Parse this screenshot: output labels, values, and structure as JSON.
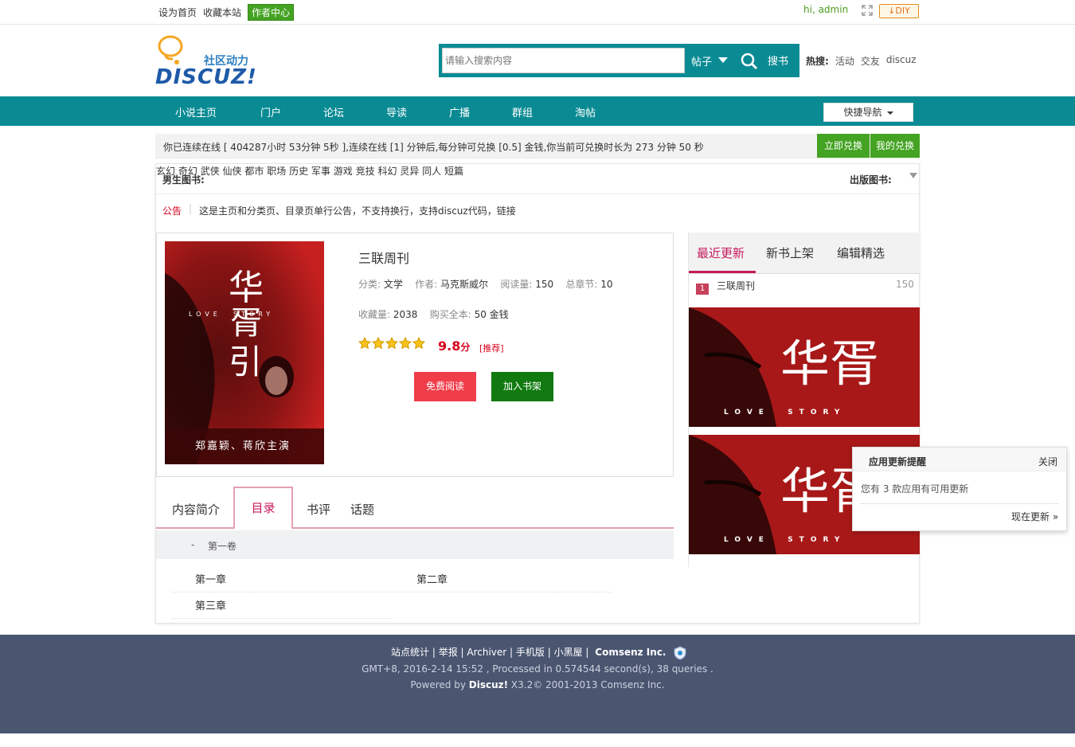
{
  "topbar": {
    "set_home": "设为首页",
    "bookmark": "收藏本站",
    "author_center": "作者中心",
    "greeting": "hi, admin",
    "diy": "DIY"
  },
  "header": {
    "logo_cn": "社区动力",
    "logo_en": "DISCUZ!",
    "search_placeholder": "请输入搜索内容",
    "search_type": "帖子",
    "search_button": "搜书",
    "hot_label": "热搜:",
    "hot_terms": [
      "活动",
      "交友",
      "discuz"
    ]
  },
  "nav": {
    "items": [
      "小说主页",
      "门户",
      "论坛",
      "导读",
      "广播",
      "群组",
      "淘帖"
    ],
    "quick_nav": "快捷导航"
  },
  "online": {
    "text": "你已连续在线 [ 404287小时 53分钟 5秒 ],连续在线 [1] 分钟后,每分钟可兑换 [0.5] 金钱,你当前可兑换时长为 273 分钟 50 秒",
    "exchange_now": "立即兑换",
    "my_exchange": "我的兑换"
  },
  "categories": {
    "male_label": "男生图书:",
    "items": [
      "玄幻",
      "奇幻",
      "武侠",
      "仙侠",
      "都市",
      "职场",
      "历史",
      "军事",
      "游戏",
      "竞技",
      "科幻",
      "灵异",
      "同人",
      "短篇"
    ],
    "publish_label": "出版图书:"
  },
  "notice": {
    "label": "公告",
    "text": "这是主页和分类页、目录页单行公告，不支持换行，支持discuz代码，链接"
  },
  "book": {
    "cover_title_lines": [
      "华",
      "胥",
      "引"
    ],
    "cover_en": "LOVE  STORY",
    "cover_caption": "郑嘉颖、蒋欣主演",
    "title": "三联周刊",
    "category_label": "分类:",
    "category": "文学",
    "author_label": "作者:",
    "author": "马克斯威尔",
    "reads_label": "阅读量:",
    "reads": "150",
    "chapters_label": "总章节:",
    "chapters": "10",
    "favorites_label": "收藏量:",
    "favorites": "2038",
    "buy_label": "购买全本:",
    "buy_price": "50 金钱",
    "rating_stars": 5,
    "score": "9.8",
    "score_unit": "分",
    "recommend": "[推荐]",
    "read_button": "免费阅读",
    "shelf_button": "加入书架"
  },
  "tabs": {
    "items": [
      "内容简介",
      "目录",
      "书评",
      "话题"
    ],
    "active": "目录"
  },
  "toc": {
    "volume_marker": "-",
    "volume": "第一卷",
    "chapters": [
      "第一章",
      "第二章",
      "第三章"
    ]
  },
  "sidebar": {
    "tabs": [
      "最近更新",
      "新书上架",
      "编辑精选"
    ],
    "rank": [
      {
        "num": "1",
        "name": "三联周刊",
        "value": "150"
      }
    ],
    "img_title": "华胥",
    "img_en": "LOVE  STORY"
  },
  "popup": {
    "title": "应用更新提醒",
    "close": "关闭",
    "message": "您有 3 款应用有可用更新",
    "link": "现在更新 »"
  },
  "footer": {
    "links": [
      "站点统计",
      "举报",
      "Archiver",
      "手机版",
      "小黑屋"
    ],
    "company": "Comsenz Inc.",
    "line2": "GMT+8, 2016-2-14 15:52 , Processed in 0.574544 second(s), 38 queries .",
    "line3_prefix": "Powered by ",
    "line3_brand": "Discuz!",
    "line3_suffix": " X3.2© 2001-2013 Comsenz Inc."
  }
}
